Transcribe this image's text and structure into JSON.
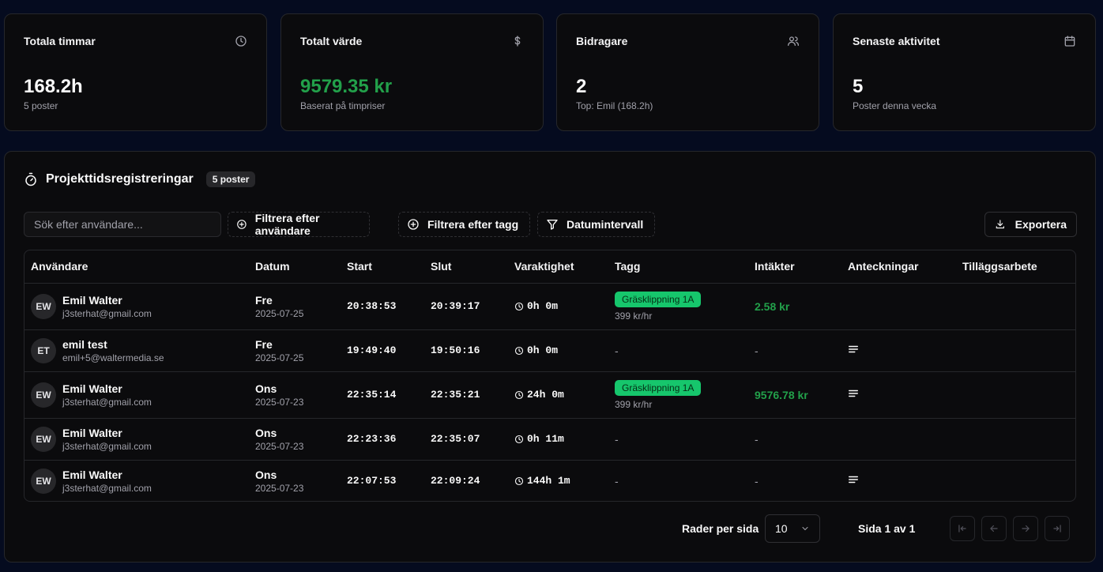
{
  "cards": [
    {
      "title": "Totala timmar",
      "value": "168.2h",
      "sub": "5 poster",
      "icon": "clock-icon"
    },
    {
      "title": "Totalt värde",
      "value": "9579.35 kr",
      "sub": "Baserat på timpriser",
      "icon": "dollar-icon"
    },
    {
      "title": "Bidragare",
      "value": "2",
      "sub": "Top: Emil (168.2h)",
      "icon": "users-icon"
    },
    {
      "title": "Senaste aktivitet",
      "value": "5",
      "sub": "Poster denna vecka",
      "icon": "calendar-icon"
    }
  ],
  "panel": {
    "title": "Projekttidsregistreringar",
    "badge": "5 poster",
    "search_placeholder": "Sök efter användare...",
    "filter_user": "Filtrera efter användare",
    "filter_tag": "Filtrera efter tagg",
    "date_range": "Datumintervall",
    "export": "Exportera"
  },
  "table": {
    "columns": [
      "Användare",
      "Datum",
      "Start",
      "Slut",
      "Varaktighet",
      "Tagg",
      "Intäkter",
      "Anteckningar",
      "Tilläggsarbete"
    ],
    "rows": [
      {
        "initials": "EW",
        "name": "Emil Walter",
        "email": "j3sterhat@gmail.com",
        "day": "Fre",
        "date": "2025-07-25",
        "start": "20:38:53",
        "end": "20:39:17",
        "duration": "0h 0m",
        "tag": "Gräsklippning 1A",
        "rate": "399 kr/hr",
        "income": "2.58 kr",
        "notes": false
      },
      {
        "initials": "ET",
        "name": "emil test",
        "email": "emil+5@waltermedia.se",
        "day": "Fre",
        "date": "2025-07-25",
        "start": "19:49:40",
        "end": "19:50:16",
        "duration": "0h 0m",
        "tag": "",
        "rate": "",
        "tag_empty": "-",
        "income": "-",
        "notes": true
      },
      {
        "initials": "EW",
        "name": "Emil Walter",
        "email": "j3sterhat@gmail.com",
        "day": "Ons",
        "date": "2025-07-23",
        "start": "22:35:14",
        "end": "22:35:21",
        "duration": "24h 0m",
        "tag": "Gräsklippning 1A",
        "rate": "399 kr/hr",
        "income": "9576.78 kr",
        "notes": true
      },
      {
        "initials": "EW",
        "name": "Emil Walter",
        "email": "j3sterhat@gmail.com",
        "day": "Ons",
        "date": "2025-07-23",
        "start": "22:23:36",
        "end": "22:35:07",
        "duration": "0h 11m",
        "tag": "",
        "rate": "",
        "tag_empty": "-",
        "income": "-",
        "notes": false
      },
      {
        "initials": "EW",
        "name": "Emil Walter",
        "email": "j3sterhat@gmail.com",
        "day": "Ons",
        "date": "2025-07-23",
        "start": "22:07:53",
        "end": "22:09:24",
        "duration": "144h 1m",
        "tag": "",
        "rate": "",
        "tag_empty": "-",
        "income": "-",
        "notes": true
      }
    ]
  },
  "pagination": {
    "rows_label": "Rader per sida",
    "rows_value": "10",
    "page_label": "Sida 1 av 1"
  },
  "colors": {
    "background": "#050b1f",
    "card": "#0b0b0d",
    "accent_green": "#22a04a",
    "tag_green": "#16c66c"
  }
}
